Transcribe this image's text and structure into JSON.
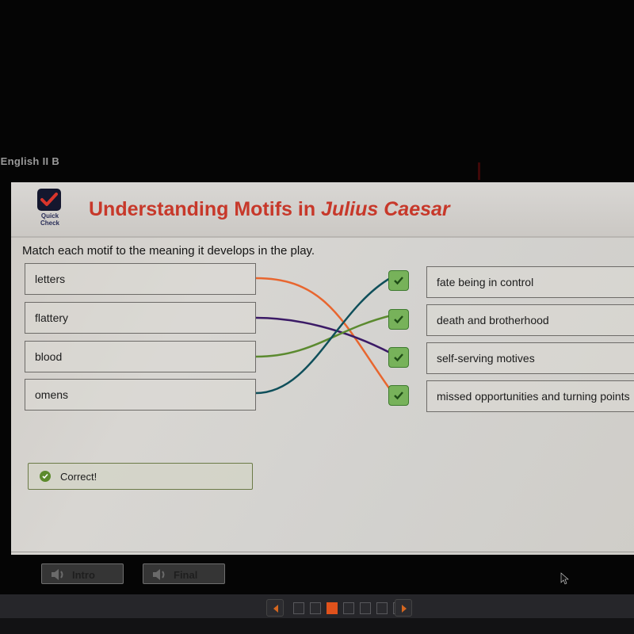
{
  "course_label": "-English II B",
  "header": {
    "quick_check_label": "Quick Check",
    "title_prefix": "Understanding Motifs in ",
    "title_italic": "Julius Caesar"
  },
  "instruction": "Match each motif to the meaning it develops in the play.",
  "motifs": [
    {
      "label": "letters",
      "line_color": "#e8662f"
    },
    {
      "label": "flattery",
      "line_color": "#3b1a66"
    },
    {
      "label": "blood",
      "line_color": "#5b8a2f"
    },
    {
      "label": "omens",
      "line_color": "#0f4f5a"
    }
  ],
  "meanings": [
    {
      "label": "fate being in control",
      "status": "correct"
    },
    {
      "label": "death and brotherhood",
      "status": "correct"
    },
    {
      "label": "self-serving motives",
      "status": "correct"
    },
    {
      "label": "missed opportunities and turning points",
      "status": "correct"
    }
  ],
  "matches": [
    {
      "motif": "letters",
      "meaning": "missed opportunities and turning points"
    },
    {
      "motif": "flattery",
      "meaning": "self-serving motives"
    },
    {
      "motif": "blood",
      "meaning": "death and brotherhood"
    },
    {
      "motif": "omens",
      "meaning": "fate being in control"
    }
  ],
  "feedback": {
    "text": "Correct!",
    "status": "correct"
  },
  "footer": {
    "buttons": [
      {
        "label": "Intro",
        "icon": "speaker-icon"
      },
      {
        "label": "Final",
        "icon": "speaker-icon"
      }
    ]
  },
  "pagination": {
    "total_pages": 7,
    "current_page": 3
  },
  "colors": {
    "title": "#c7382a",
    "accent": "#e0521c",
    "correct": "#5c8a2c"
  }
}
